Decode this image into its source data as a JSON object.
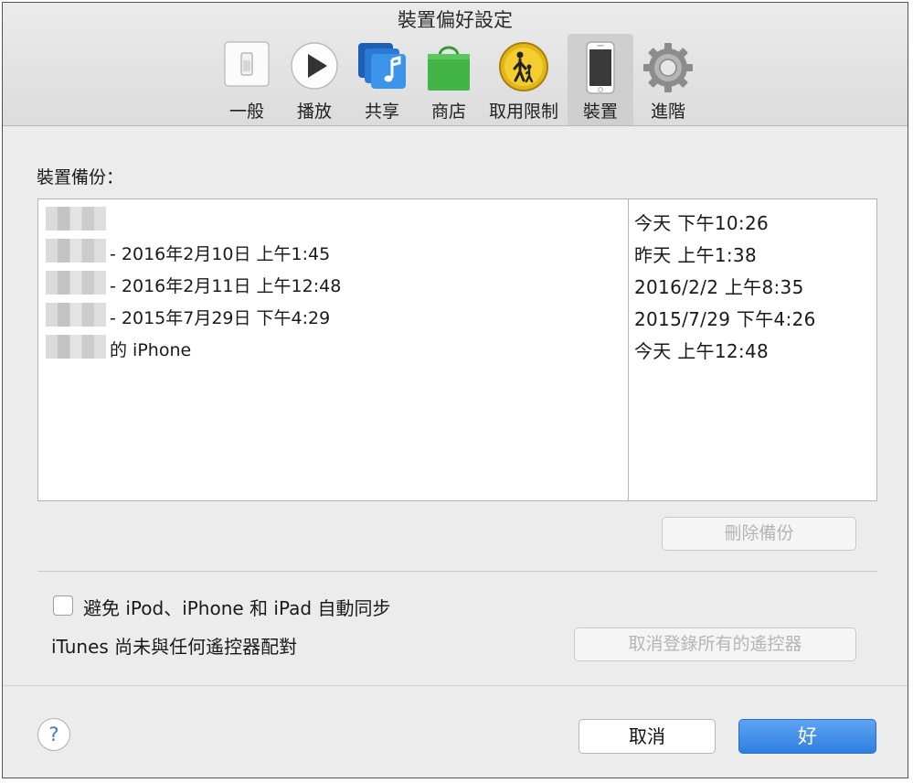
{
  "window": {
    "title": "裝置偏好設定"
  },
  "toolbar": {
    "items": [
      {
        "label": "一般",
        "icon": "general-switch-icon"
      },
      {
        "label": "播放",
        "icon": "playback-icon"
      },
      {
        "label": "共享",
        "icon": "sharing-icon"
      },
      {
        "label": "商店",
        "icon": "store-bag-icon"
      },
      {
        "label": "取用限制",
        "icon": "parental-controls-icon"
      },
      {
        "label": "裝置",
        "icon": "device-iphone-icon",
        "selected": true
      },
      {
        "label": "進階",
        "icon": "gear-icon"
      }
    ]
  },
  "backups": {
    "section_label": "裝置備份：",
    "rows": [
      {
        "name": "",
        "date": "今天 下午10:26"
      },
      {
        "name": "- 2016年2月10日 上午1:45",
        "date": "昨天 上午1:38"
      },
      {
        "name": "- 2016年2月11日 上午12:48",
        "date": "2016/2/2 上午8:35"
      },
      {
        "name": "- 2015年7月29日 下午4:29",
        "date": "2015/7/29 下午4:26"
      },
      {
        "name": "的 iPhone",
        "date": "今天 上午12:48"
      }
    ],
    "delete_button": "刪除備份"
  },
  "sync": {
    "prevent_sync_label": "避免 iPod、iPhone 和 iPad 自動同步",
    "prevent_sync_checked": false
  },
  "remotes": {
    "status_text": "iTunes 尚未與任何遙控器配對",
    "unpair_button": "取消登錄所有的遙控器"
  },
  "footer": {
    "help": "?",
    "cancel_button": "取消",
    "ok_button": "好"
  },
  "colors": {
    "accent": "#3b86e6",
    "selected_tab": "#cfcfcf"
  }
}
